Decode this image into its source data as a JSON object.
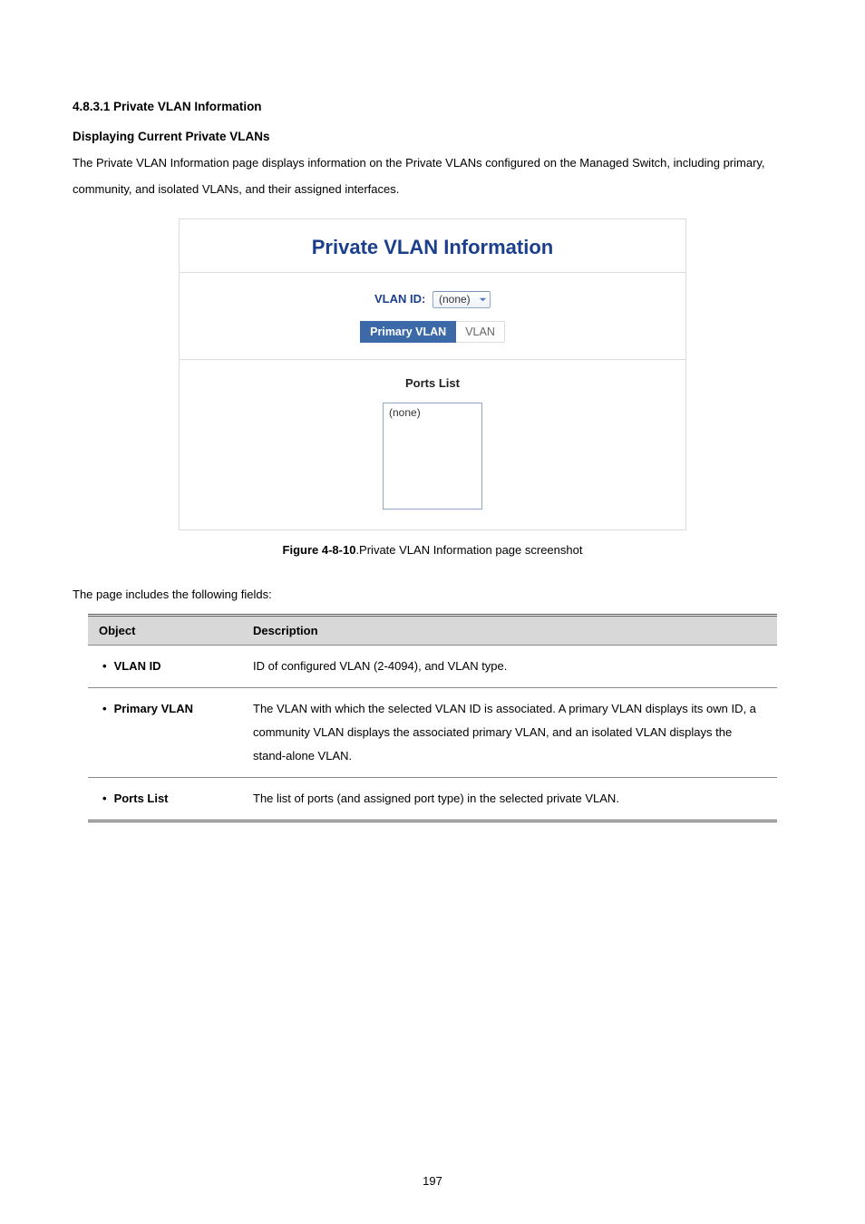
{
  "headings": {
    "section_number": "4.8.3.1 Private VLAN Information",
    "sub": "Displaying Current Private VLANs"
  },
  "paragraph": "The Private VLAN Information page displays information on the Private VLANs configured on the Managed Switch, including primary, community, and isolated VLANs, and their assigned interfaces.",
  "figure": {
    "panel_title": "Private VLAN Information",
    "vlan_id_label": "VLAN ID:",
    "vlan_id_value": "(none)",
    "primary_vlan_header": "Primary VLAN",
    "primary_vlan_value": "VLAN",
    "ports_list_title": "Ports List",
    "ports_list_value": "(none)",
    "caption_bold": "Figure 4-8-10",
    "caption_rest": ".Private VLAN Information page screenshot"
  },
  "fields_intro": "The page includes the following fields:",
  "table": {
    "head_object": "Object",
    "head_description": "Description",
    "rows": [
      {
        "object": "VLAN ID",
        "desc": "ID of configured VLAN (2-4094), and VLAN type."
      },
      {
        "object": "Primary VLAN",
        "desc": "The VLAN with which the selected VLAN ID is associated. A primary VLAN displays its own ID, a community VLAN displays the associated primary VLAN, and an isolated VLAN displays the stand-alone VLAN."
      },
      {
        "object": "Ports List",
        "desc": "The list of ports (and assigned port type) in the selected private VLAN."
      }
    ]
  },
  "page_number": "197"
}
